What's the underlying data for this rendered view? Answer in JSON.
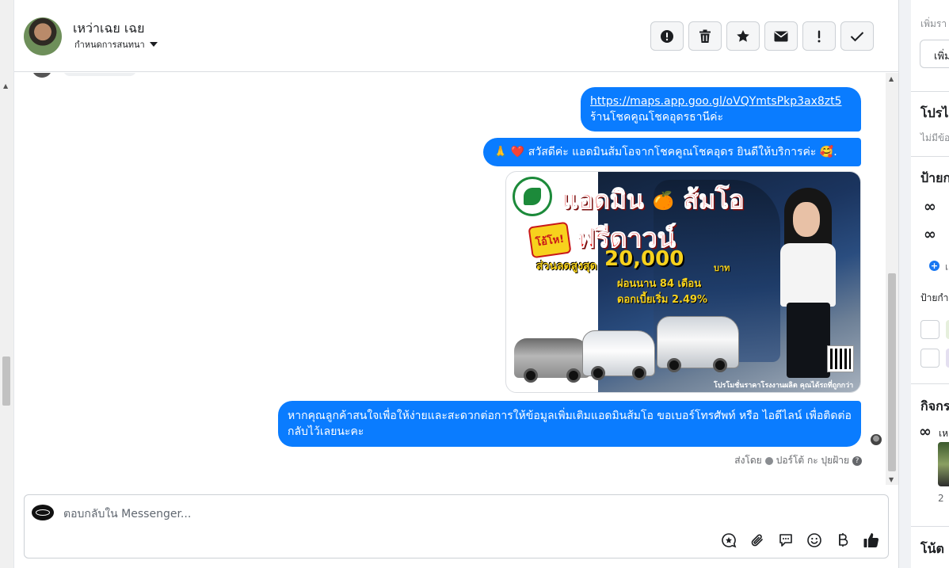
{
  "header": {
    "contact_name": "เหว่าเฉย เฉย",
    "assign_label": "กำหนดการสนทนา",
    "action_icons": [
      "alert-circle-icon",
      "trash-icon",
      "star-icon",
      "envelope-icon",
      "exclamation-icon",
      "check-icon"
    ]
  },
  "messages": [
    {
      "type": "text",
      "link": "https://maps.app.goo.gl/oVQYmtsPkp3ax8zt5",
      "text": "ร้านโชคคูณโชคอุดรธานีค่ะ"
    },
    {
      "type": "text",
      "emoji_prefix": "🙏 ❤️",
      "text": "สวัสดีค่ะ แอดมินส้มโอจากโชคคูณโชคอุดร ยินดีให้บริการค่ะ",
      "emoji_suffix": "🥰."
    },
    {
      "type": "image",
      "image": {
        "headline": "แอดมิน",
        "headline2": "ส้มโอ",
        "badge": "โอ้โห!",
        "offer": "ฟรีดาวน์",
        "discount_label": "ส่วนลดสูงสุด",
        "discount_amount": "20,000",
        "discount_unit": "บาท",
        "installment": "ผ่อนนาน 84 เดือน",
        "rate": "ดอกเบี้ยเริ่ม 2.49%",
        "footer": "โปรโมชั่นราคาโรงงานผลิต คุณได้รถที่ถูกกว่า"
      }
    },
    {
      "type": "text",
      "text": "หากคุณลูกค้าสนใจเพื่อให้ง่ายและสะดวกต่อการให้ข้อมูลเพิ่มเติมแอดมินส้มโอ ขอเบอร์โทรศัพท์ หรือ ไอดีไลน์ เพื่อติดต่อกลับไว้เลยนะคะ"
    }
  ],
  "sent_by": {
    "prefix": "ส่งโดย",
    "name": "ปอร์โต้ กะ ปุยฝ้าย"
  },
  "composer": {
    "placeholder": "ตอบกลับใน Messenger...",
    "tools": [
      "saved-reply-icon",
      "attachment-icon",
      "chat-bubble-icon",
      "emoji-icon",
      "baht-icon",
      "thumbs-up-icon"
    ]
  },
  "sidebar": {
    "add_hint": "เพิ่มรา",
    "add_button": "เพิ่ม",
    "profile_heading": "โปรไ",
    "profile_note": "ไม่มีข้อ",
    "labels_heading": "ป้ายก",
    "add_label_short": "เ",
    "labels_sub": "ป้ายกำ",
    "activity_heading": "กิจกร",
    "activity_item": "เห",
    "activity_count": "2",
    "notes_heading": "โน้ต"
  },
  "colors": {
    "bubble_blue": "#0a7cff",
    "accent_blue": "#1877f2",
    "text_primary": "#1c1e21",
    "text_secondary": "#65676b",
    "border": "#ccd0d5"
  }
}
